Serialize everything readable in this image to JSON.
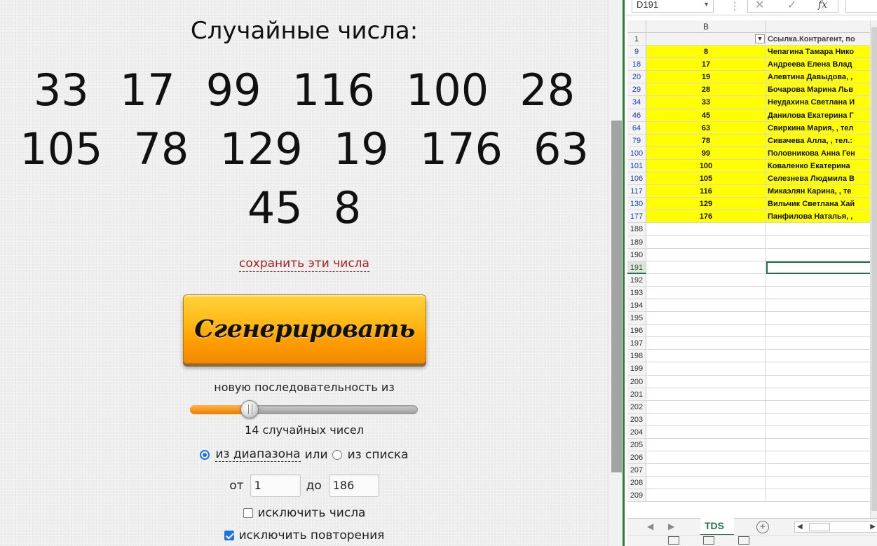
{
  "page": {
    "heading": "Случайные числа:",
    "numbers_row1": [
      "33",
      "17",
      "99",
      "116",
      "100",
      "28"
    ],
    "numbers_row2": [
      "105",
      "78",
      "129",
      "19",
      "176",
      "63"
    ],
    "numbers_row3": [
      "45",
      "8"
    ],
    "save_link": "сохранить эти числа",
    "generate_button": "Сгенерировать",
    "sequence_label": "новую последовательность из",
    "slider_value_fraction": 0.26,
    "count_label": "14 случайных чисел",
    "option_range": "из диапазона",
    "option_or": "или",
    "option_list": "из списка",
    "option_selected": "range",
    "from_label": "от",
    "from_value": "1",
    "to_label": "до",
    "to_value": "186",
    "exclude_numbers": {
      "label": "исключить числа",
      "checked": false
    },
    "exclude_repeats": {
      "label": "исключить повторения",
      "checked": true
    },
    "colors": {
      "link": "#a0241c",
      "button": "#ffb614",
      "accent": "#1a73e8"
    }
  },
  "excel": {
    "name_box": "D191",
    "formula_icons": {
      "cancel": "cancel-icon",
      "enter": "check-icon",
      "fx": "fx"
    },
    "columns": {
      "b": "B"
    },
    "header_row": {
      "num": "1",
      "c_text": "Ссылка.Контрагент, по"
    },
    "filtered_rows": [
      {
        "num": "9",
        "b": "8",
        "c": "Чепагина Тамара Нико"
      },
      {
        "num": "18",
        "b": "17",
        "c": "Андреева Елена Влад"
      },
      {
        "num": "20",
        "b": "19",
        "c": " Алевтина Давыдова, ,"
      },
      {
        "num": "29",
        "b": "28",
        "c": "Бочарова Марина Льв"
      },
      {
        "num": "34",
        "b": "33",
        "c": "Неудахина Светлана И"
      },
      {
        "num": "46",
        "b": "45",
        "c": "Данилова Екатерина Г"
      },
      {
        "num": "64",
        "b": "63",
        "c": "Свиркина Мария, , тел"
      },
      {
        "num": "79",
        "b": "78",
        "c": "Сивачева Алла, , тел.:"
      },
      {
        "num": "100",
        "b": "99",
        "c": "Половникова Анна Ген"
      },
      {
        "num": "101",
        "b": "100",
        "c": "Коваленко Екатерина"
      },
      {
        "num": "106",
        "b": "105",
        "c": "Селезнева Людмила В"
      },
      {
        "num": "117",
        "b": "116",
        "c": "Микаэлян Карина, , те"
      },
      {
        "num": "130",
        "b": "129",
        "c": "Вильчик Светлана Хай"
      },
      {
        "num": "177",
        "b": "176",
        "c": "Панфилова Наталья, ,"
      }
    ],
    "empty_rows": [
      "188",
      "189",
      "190",
      "191",
      "192",
      "193",
      "194",
      "195",
      "196",
      "197",
      "198",
      "199",
      "200",
      "201",
      "202",
      "203",
      "204",
      "205",
      "206",
      "207",
      "208",
      "209"
    ],
    "active_row": "191",
    "sheet_tab": "TDS",
    "colors": {
      "highlight": "#ffff00",
      "excel_green": "#217346"
    }
  }
}
